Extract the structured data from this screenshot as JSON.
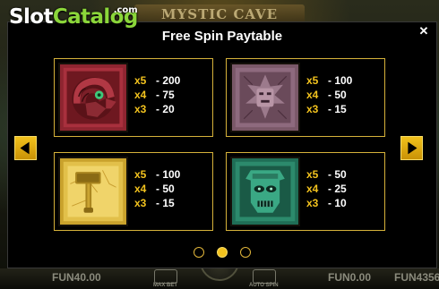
{
  "brand": {
    "slot": "Slot",
    "catalog": "Catalog",
    "com": ".com"
  },
  "background": {
    "game_title": "MYSTIC CAVE"
  },
  "modal": {
    "title": "Free Spin Paytable",
    "close_icon": "close-icon",
    "prev_icon": "arrow-left-icon",
    "next_icon": "arrow-right-icon"
  },
  "symbols": [
    {
      "icon": "serpent-medallion-icon",
      "color": "#8e2530",
      "pays": [
        {
          "mult": "x5",
          "value": "- 200"
        },
        {
          "mult": "x4",
          "value": "- 75"
        },
        {
          "mult": "x3",
          "value": "- 20"
        }
      ]
    },
    {
      "icon": "stone-mask-icon",
      "color": "#8a6478",
      "pays": [
        {
          "mult": "x5",
          "value": "- 100"
        },
        {
          "mult": "x4",
          "value": "- 50"
        },
        {
          "mult": "x3",
          "value": "- 15"
        }
      ]
    },
    {
      "icon": "golden-hammer-icon",
      "color": "#d4b030",
      "pays": [
        {
          "mult": "x5",
          "value": "- 100"
        },
        {
          "mult": "x4",
          "value": "- 50"
        },
        {
          "mult": "x3",
          "value": "- 15"
        }
      ]
    },
    {
      "icon": "jade-mask-icon",
      "color": "#2a8a6c",
      "pays": [
        {
          "mult": "x5",
          "value": "- 50"
        },
        {
          "mult": "x4",
          "value": "- 25"
        },
        {
          "mult": "x3",
          "value": "- 10"
        }
      ]
    }
  ],
  "pagination": {
    "pages": 3,
    "active": 2
  },
  "bottom_bar": {
    "bet": "FUN40.00",
    "max_bet_label": "MAX BET",
    "auto_spin_label": "AUTO SPIN",
    "win": "FUN0.00",
    "balance": "FUN4356"
  },
  "colors": {
    "accent": "#f3c31e",
    "card_border": "#d6b23a",
    "brand_green": "#8bd63a"
  }
}
